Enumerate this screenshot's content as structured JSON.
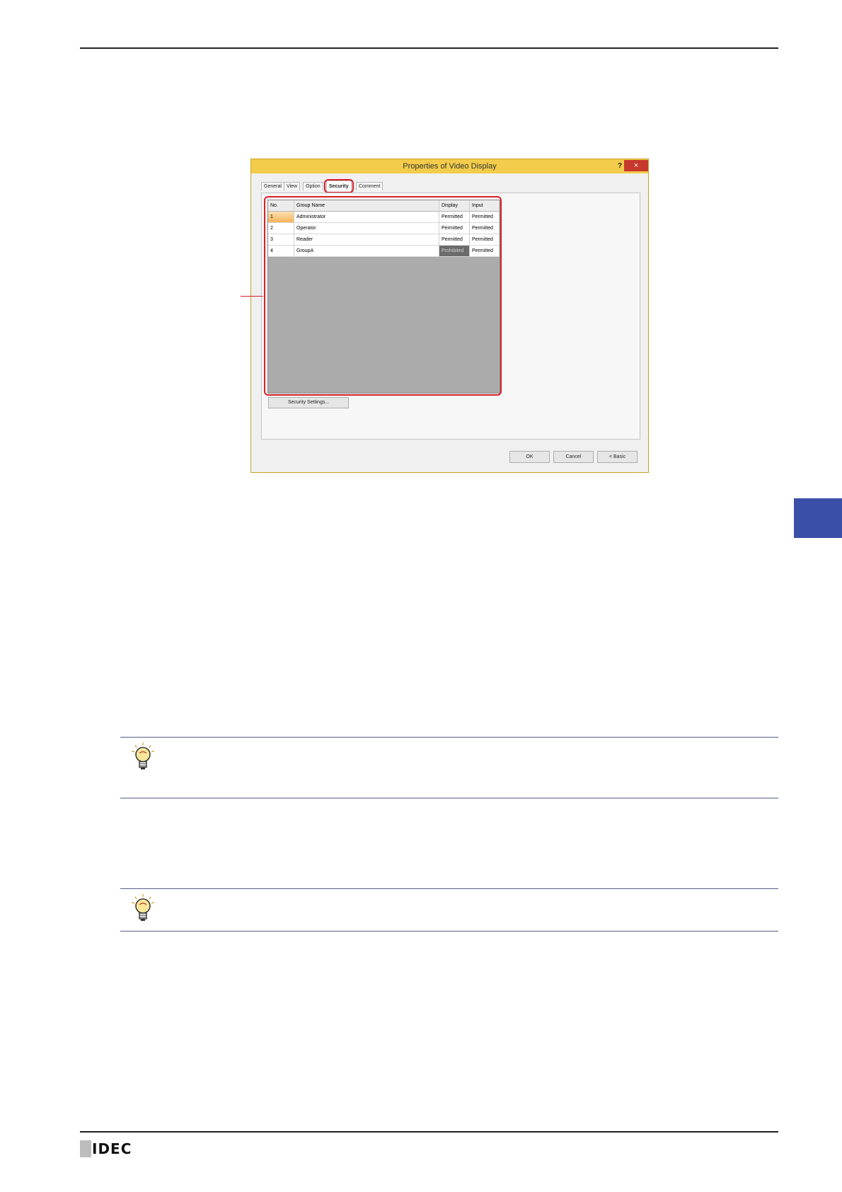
{
  "dialog": {
    "title": "Properties of Video Display",
    "help_label": "?",
    "close_label": "×",
    "tabs": [
      "General",
      "View",
      "Option",
      "Security",
      "Comment"
    ],
    "active_tab": "Security",
    "grid": {
      "headers": [
        "No.",
        "Group Name",
        "Display",
        "Input"
      ],
      "rows": [
        {
          "no": "1",
          "name": "Administrator",
          "display": "Permitted",
          "input": "Permitted"
        },
        {
          "no": "2",
          "name": "Operator",
          "display": "Permitted",
          "input": "Permitted"
        },
        {
          "no": "3",
          "name": "Reader",
          "display": "Permitted",
          "input": "Permitted"
        },
        {
          "no": "4",
          "name": "GroupA",
          "display": "Prohibited",
          "input": "Permitted"
        }
      ]
    },
    "security_settings_label": "Security Settings...",
    "ok_label": "OK",
    "cancel_label": "Cancel",
    "basic_label": "< Basic"
  },
  "footer": {
    "logo_text": "IDEC"
  },
  "colors": {
    "accent_red": "#d6202a",
    "side_tab": "#3a4fa8",
    "titlebar": "#f2cc4a"
  }
}
